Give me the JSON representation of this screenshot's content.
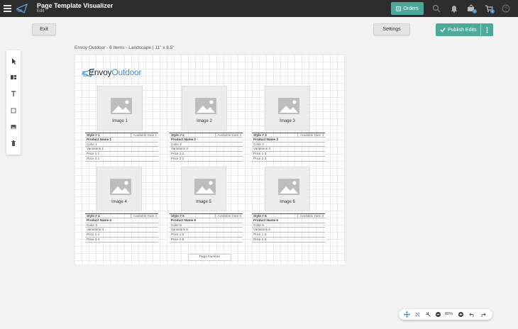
{
  "app": {
    "title": "Page Template Visualizer",
    "subtitle": "Edit",
    "orders_label": "Orders",
    "cart_badge_1": "1",
    "cart_badge_2": "1"
  },
  "actions": {
    "exit_label": "Exit",
    "settings_label": "Settings",
    "publish_label": "Publish Edits"
  },
  "document": {
    "label": "Envoy Outdoor - 6 Items - Landscape | 11\" x 8.5\"",
    "brand_part1": "Envoy",
    "brand_part2": "Outdoor",
    "page_number": "Page Number"
  },
  "items": [
    {
      "image": "Image 1",
      "style": "Style # 1",
      "available": "Available Date 1",
      "name": "Product Name 1",
      "color": "Color 1",
      "variations": "Variations 1",
      "price1": "Price 1 1",
      "price2": "Price 2 1"
    },
    {
      "image": "Image 2",
      "style": "Style # 2",
      "available": "Available Date 2",
      "name": "Product Name 2",
      "color": "Color 2",
      "variations": "Variations 2",
      "price1": "Price 1 2",
      "price2": "Price 2 2"
    },
    {
      "image": "Image 3",
      "style": "Style # 3",
      "available": "Available Date 3",
      "name": "Product Name 3",
      "color": "Color 3",
      "variations": "Variations 3",
      "price1": "Price 1 3",
      "price2": "Price 2 3"
    },
    {
      "image": "Image 4",
      "style": "Style # 4",
      "available": "Available Date 4",
      "name": "Product Name 4",
      "color": "Color 4",
      "variations": "Variations 4",
      "price1": "Price 1 4",
      "price2": "Price 2 4"
    },
    {
      "image": "Image 5",
      "style": "Style # 5",
      "available": "Available Date 5",
      "name": "Product Name 5",
      "color": "Color 5",
      "variations": "Variations 5",
      "price1": "Price 1 5",
      "price2": "Price 2 5"
    },
    {
      "image": "Image 6",
      "style": "Style # 6",
      "available": "Available Date 6",
      "name": "Product Name 6",
      "color": "Color 6",
      "variations": "Variations 6",
      "price1": "Price 1 6",
      "price2": "Price 2 6"
    }
  ],
  "zoom": {
    "value": "80%"
  },
  "colors": {
    "accent": "#4fa99b",
    "topbar": "#2d2d2d",
    "brand_blue": "#3f8fd2"
  },
  "toolbar_icons": [
    "select-icon",
    "layout-icon",
    "text-icon",
    "shape-icon",
    "image-icon",
    "trash-icon"
  ]
}
